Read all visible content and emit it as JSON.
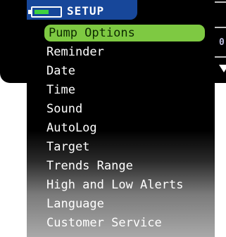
{
  "header": {
    "title": "SETUP",
    "icon": "battery-icon"
  },
  "menu": {
    "items": [
      {
        "label": "Pump Options"
      },
      {
        "label": "Reminder"
      },
      {
        "label": "Date"
      },
      {
        "label": "Time"
      },
      {
        "label": "Sound"
      },
      {
        "label": "AutoLog"
      },
      {
        "label": "Target"
      },
      {
        "label": "Trends Range"
      },
      {
        "label": "High and Low Alerts"
      },
      {
        "label": "Language"
      },
      {
        "label": "Customer Service"
      }
    ],
    "selected": "Pump Options"
  },
  "side_panel": {
    "value": "0"
  },
  "colors": {
    "header": "#17479a",
    "selected": "#7ec942",
    "background": "#000000"
  }
}
